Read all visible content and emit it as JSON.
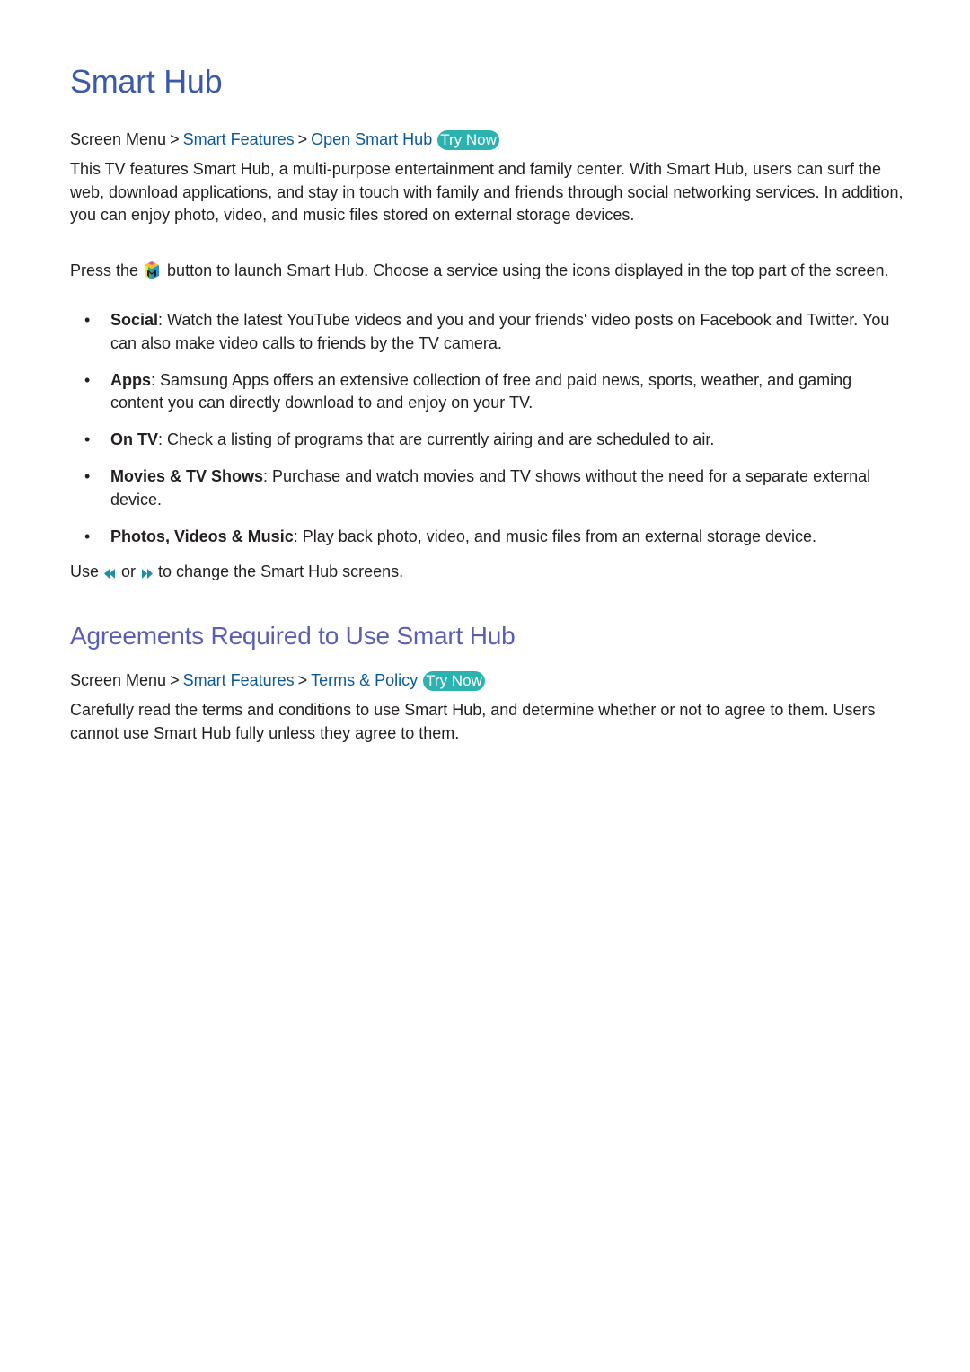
{
  "title": "Smart Hub",
  "section1": {
    "breadcrumb": [
      "Screen Menu",
      "Smart Features",
      "Open Smart Hub"
    ],
    "try_now": "Try Now",
    "intro": "This TV features Smart Hub, a multi-purpose entertainment and family center. With Smart Hub, users can surf the web, download applications, and stay in touch with family and friends through social networking services. In addition, you can enjoy photo, video, and music files stored on external storage devices.",
    "press_before": "Press the",
    "press_after": "button to launch Smart Hub. Choose a service using the icons displayed in the top part of the screen.",
    "bullets": [
      {
        "term": "Social",
        "text": ": Watch the latest YouTube videos and you and your friends' video posts on Facebook and Twitter. You can also make video calls to friends by the TV camera."
      },
      {
        "term": "Apps",
        "text": ": Samsung Apps offers an extensive collection of free and paid news, sports, weather, and gaming content you can directly download to and enjoy on your TV."
      },
      {
        "term": "On TV",
        "text": ": Check a listing of programs that are currently airing and are scheduled to air."
      },
      {
        "term": "Movies & TV Shows",
        "text": ": Purchase and watch movies and TV shows without the need for a separate external device."
      },
      {
        "term": "Photos, Videos & Music",
        "text": ": Play back photo, video, and music files from an external storage device."
      }
    ],
    "use_before": "Use",
    "use_or": "or",
    "use_after": "to change the Smart Hub screens."
  },
  "section2": {
    "heading": "Agreements Required to Use Smart Hub",
    "breadcrumb": [
      "Screen Menu",
      "Smart Features",
      "Terms & Policy"
    ],
    "try_now": "Try Now",
    "text": "Carefully read the terms and conditions to use Smart Hub, and determine whether or not to agree to them. Users cannot use Smart Hub fully unless they agree to them."
  },
  "icons": {
    "smart_hub_button": "smart-hub-icon",
    "rewind": "rewind-icon",
    "fast_forward": "fast-forward-icon"
  },
  "colors": {
    "title": "#3a5aa8",
    "subheading": "#5a5fb5",
    "link": "#0b5a97",
    "try_now_bg": "#2cb3b0",
    "body_text": "#231f20"
  }
}
